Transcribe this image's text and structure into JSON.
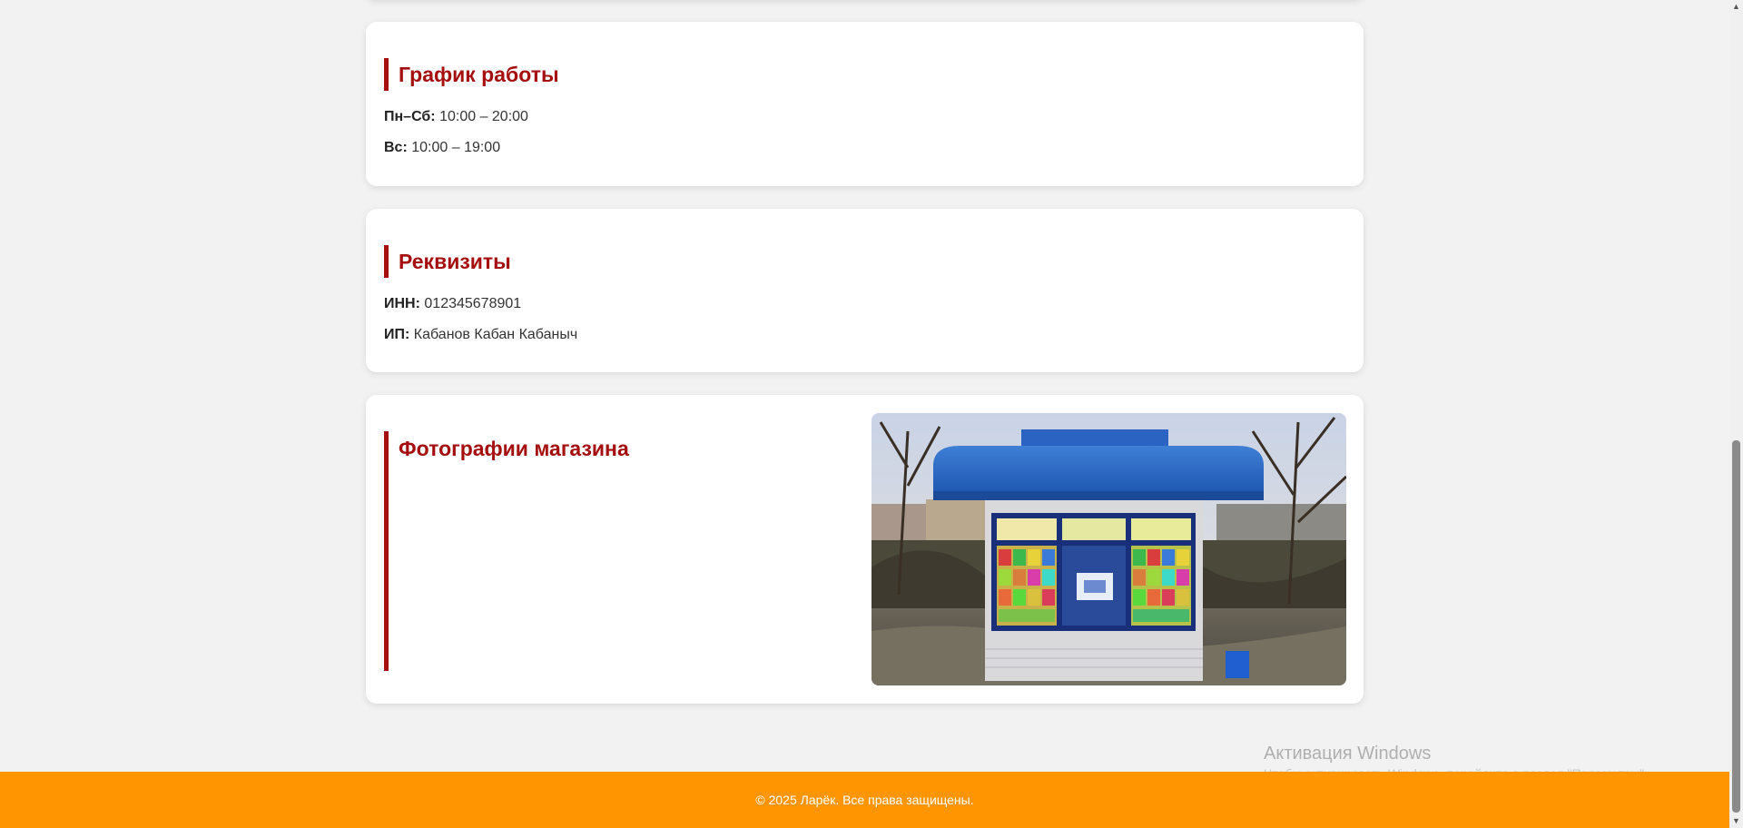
{
  "schedule": {
    "title": "График работы",
    "weekdays_label": "Пн–Сб:",
    "weekdays_hours": "10:00 – 20:00",
    "sunday_label": "Вс:",
    "sunday_hours": "10:00 – 19:00"
  },
  "requisites": {
    "title": "Реквизиты",
    "inn_label": "ИНН:",
    "inn_value": "012345678901",
    "ip_label": "ИП:",
    "ip_value": "Кабанов Кабан Кабаныч"
  },
  "photos": {
    "title": "Фотографии магазина",
    "image_alt": "Фото киоска"
  },
  "footer": {
    "text": "© 2025 Ларёк. Все права защищены."
  },
  "windows_watermark": {
    "title": "Активация Windows",
    "subtitle": "Чтобы активировать Windows, перейдите в раздел \"Параметры\"."
  },
  "colors": {
    "accent": "#a50f0f",
    "footer_bg": "#ff9500",
    "page_bg": "#f2f2f2",
    "card_bg": "#ffffff"
  }
}
